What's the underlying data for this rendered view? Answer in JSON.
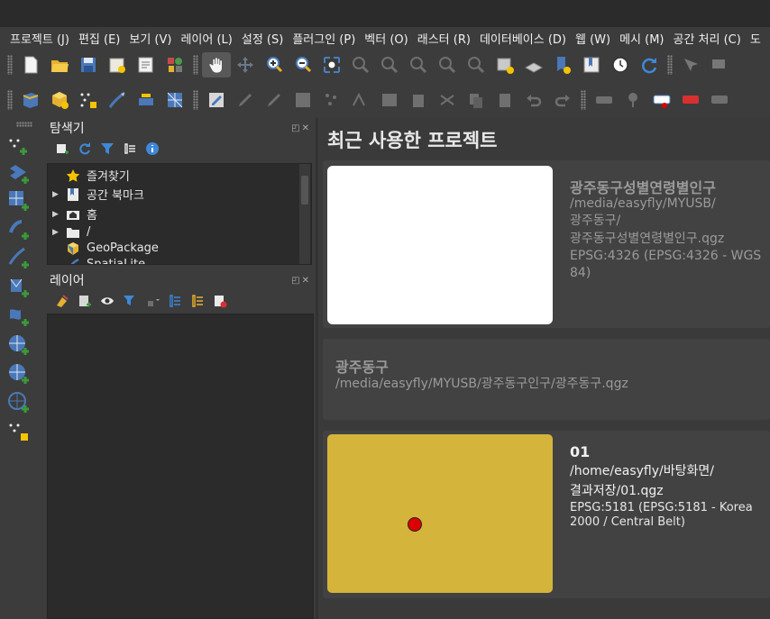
{
  "menubar": {
    "items": [
      "프로젝트 (J)",
      "편집 (E)",
      "보기 (V)",
      "레이어 (L)",
      "설정 (S)",
      "플러그인 (P)",
      "벡터 (O)",
      "래스터 (R)",
      "데이터베이스 (D)",
      "웹 (W)",
      "메시 (M)",
      "공간 처리 (C)",
      "도"
    ]
  },
  "browser_panel": {
    "title": "탐색기",
    "tree": [
      "즐겨찾기",
      "공간 북마크",
      "홈",
      "/",
      "GeoPackage",
      "SpatiaLite"
    ]
  },
  "layers_panel": {
    "title": "레이어"
  },
  "welcome": {
    "title": "최근 사용한 프로젝트",
    "projects": [
      {
        "name": "광주동구성별연령별인구",
        "path_lines": [
          "/media/easyfly/MYUSB/",
          "광주동구/",
          "광주동구성별연령별인구.qgz"
        ],
        "crs": "EPSG:4326 (EPSG:4326 - WGS 84)"
      },
      {
        "name": "광주동구",
        "path_lines": [
          "/media/easyfly/MYUSB/광주동구인구/광주동구.qgz"
        ]
      },
      {
        "name": "01",
        "path_lines": [
          "/home/easyfly/바탕화면/",
          "결과저장/01.qgz"
        ],
        "crs_lines": [
          "EPSG:5181 (EPSG:5181 - Korea",
          "2000 / Central Belt)"
        ]
      }
    ]
  },
  "colors": {
    "background": "#3c3c3c",
    "panel_bg": "#2b2b2b",
    "map_thumb": "#d4b43a",
    "point": "#dd0000"
  }
}
